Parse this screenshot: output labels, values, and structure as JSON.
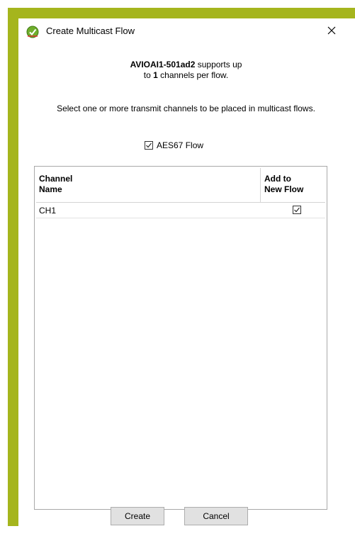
{
  "dialog": {
    "title": "Create Multicast Flow",
    "close_label": "✕"
  },
  "info": {
    "device": "AVIOAI1-501ad2",
    "supports_text": " supports up",
    "line2_prefix": "to ",
    "channels_count": "1",
    "line2_suffix": " channels per flow.",
    "instruction": "Select one or more transmit channels to be placed in multicast flows."
  },
  "aes67": {
    "label": "AES67 Flow",
    "checked": true
  },
  "table": {
    "col_name": "Channel\nName",
    "col_name_line1": "Channel",
    "col_name_line2": "Name",
    "col_add_line1": "Add to",
    "col_add_line2": "New Flow",
    "rows": [
      {
        "name": "CH1",
        "checked": true
      }
    ]
  },
  "buttons": {
    "create_label": "Create",
    "cancel_label": "Cancel"
  },
  "colors": {
    "annotation": "#a5b51d"
  }
}
